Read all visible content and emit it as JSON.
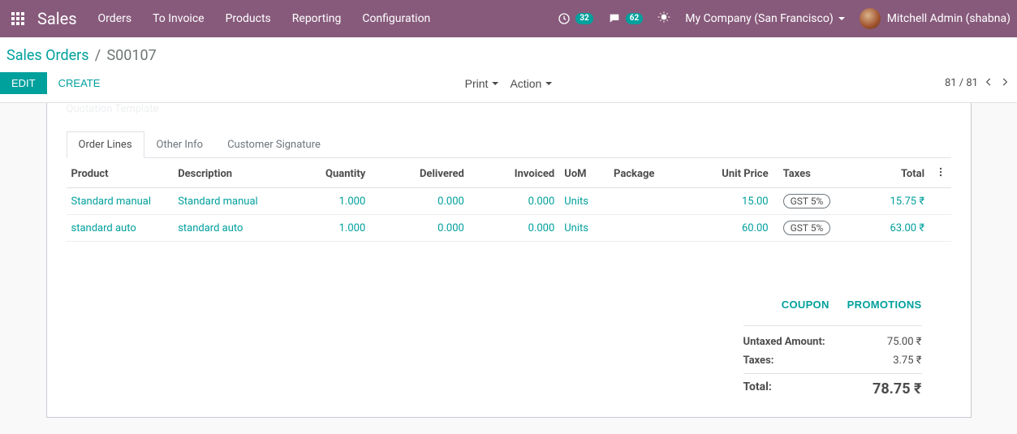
{
  "header": {
    "brand": "Sales",
    "menu": [
      "Orders",
      "To Invoice",
      "Products",
      "Reporting",
      "Configuration"
    ],
    "activity_badge": "32",
    "discuss_badge": "62",
    "company": "My Company (San Francisco)",
    "user": "Mitchell Admin (shabna)"
  },
  "breadcrumb": {
    "parent": "Sales Orders",
    "current": "S00107"
  },
  "controlbar": {
    "edit": "EDIT",
    "create": "CREATE",
    "print": "Print",
    "action": "Action",
    "pager": "81 / 81"
  },
  "sheet": {
    "faded_field": "Quotation Template",
    "tabs": {
      "order_lines": "Order Lines",
      "other_info": "Other Info",
      "customer_signature": "Customer Signature"
    },
    "columns": {
      "product": "Product",
      "description": "Description",
      "quantity": "Quantity",
      "delivered": "Delivered",
      "invoiced": "Invoiced",
      "uom": "UoM",
      "package": "Package",
      "unit_price": "Unit Price",
      "taxes": "Taxes",
      "total": "Total"
    },
    "rows": [
      {
        "product": "Standard manual",
        "description": "Standard manual",
        "quantity": "1.000",
        "delivered": "0.000",
        "invoiced": "0.000",
        "uom": "Units",
        "package": "",
        "unit_price": "15.00",
        "tax": "GST 5%",
        "total": "15.75 ₹"
      },
      {
        "product": "standard auto",
        "description": "standard auto",
        "quantity": "1.000",
        "delivered": "0.000",
        "invoiced": "0.000",
        "uom": "Units",
        "package": "",
        "unit_price": "60.00",
        "tax": "GST 5%",
        "total": "63.00 ₹"
      }
    ],
    "promo": {
      "coupon": "COUPON",
      "promotions": "PROMOTIONS"
    },
    "totals": {
      "untaxed_label": "Untaxed Amount:",
      "untaxed_value": "75.00 ₹",
      "taxes_label": "Taxes:",
      "taxes_value": "3.75 ₹",
      "total_label": "Total:",
      "total_value": "78.75 ₹"
    }
  }
}
